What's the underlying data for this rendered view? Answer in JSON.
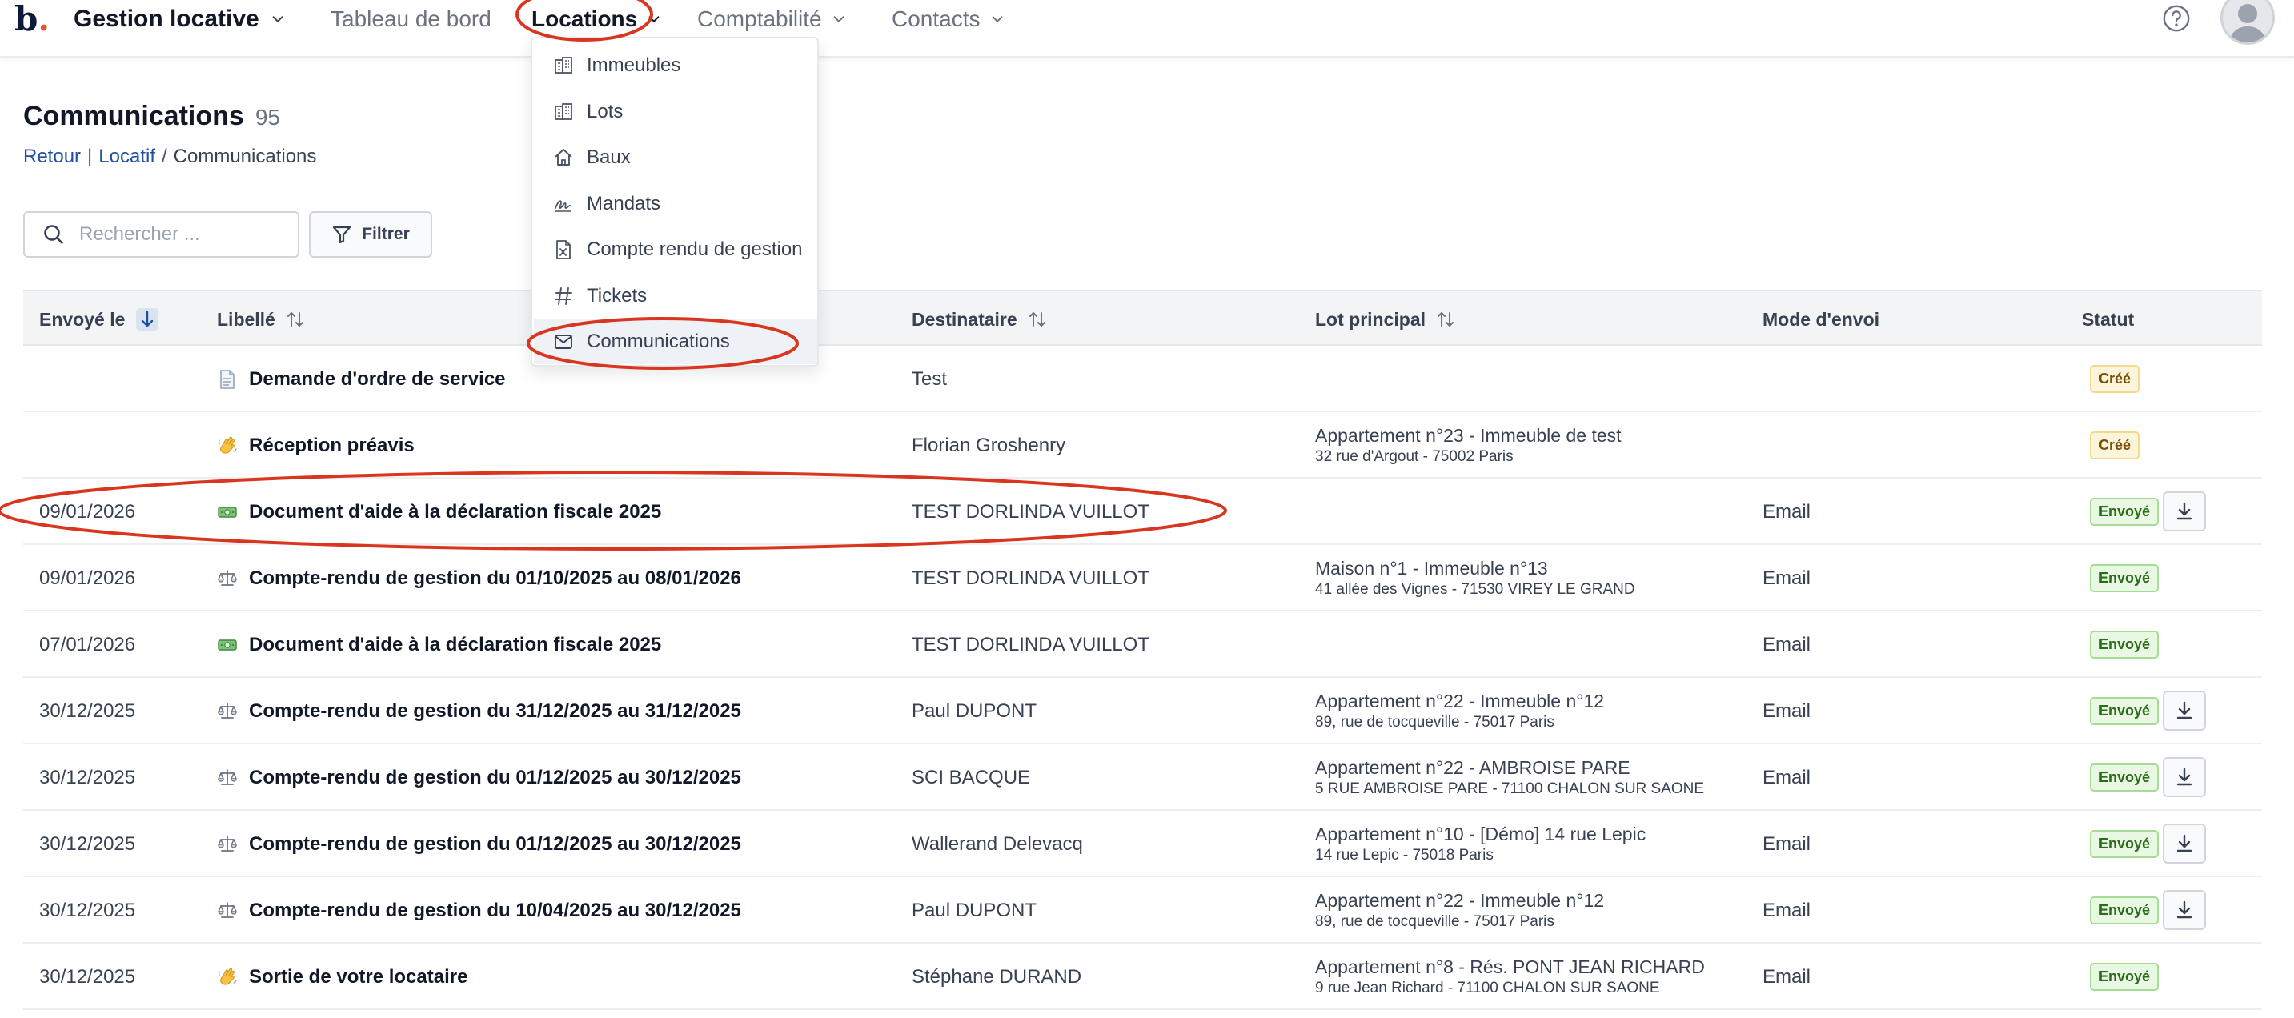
{
  "app": {
    "logo_letter": "b",
    "logo_dot": ".",
    "title": "Gestion locative"
  },
  "nav": {
    "items": [
      {
        "label": "Tableau de bord"
      },
      {
        "label": "Locations"
      },
      {
        "label": "Comptabilité"
      },
      {
        "label": "Contacts"
      }
    ]
  },
  "dropdown": {
    "items": [
      {
        "label": "Immeubles",
        "icon": "building-icon"
      },
      {
        "label": "Lots",
        "icon": "building-icon"
      },
      {
        "label": "Baux",
        "icon": "home-icon"
      },
      {
        "label": "Mandats",
        "icon": "signature-icon"
      },
      {
        "label": "Compte rendu de gestion",
        "icon": "spreadsheet-icon"
      },
      {
        "label": "Tickets",
        "icon": "hash-icon"
      },
      {
        "label": "Communications",
        "icon": "envelope-icon",
        "selected": true
      }
    ]
  },
  "page": {
    "title": "Communications",
    "count": "95",
    "breadcrumb": {
      "back": "Retour",
      "sep1": "|",
      "section": "Locatif",
      "sep2": "/",
      "current": "Communications"
    }
  },
  "toolbar": {
    "search_placeholder": "Rechercher ...",
    "filter_label": "Filtrer"
  },
  "table": {
    "columns": {
      "sent": "Envoyé le",
      "label": "Libellé",
      "recipient": "Destinataire",
      "lot": "Lot principal",
      "mode": "Mode d'envoi",
      "status": "Statut"
    },
    "rows": [
      {
        "date": "",
        "icon": "document-icon",
        "label": "Demande d'ordre de service",
        "recipient": "Test",
        "lot_name": "",
        "lot_address": "",
        "mode": "",
        "status": "Créé",
        "download": false
      },
      {
        "date": "",
        "icon": "waving-hand-icon",
        "label": "Réception préavis",
        "recipient": "Florian Groshenry",
        "lot_name": "Appartement n°23 - Immeuble de test",
        "lot_address": "32 rue d'Argout - 75002 Paris",
        "mode": "",
        "status": "Créé",
        "download": false
      },
      {
        "date": "09/01/2026",
        "icon": "banknote-icon",
        "label": "Document d'aide à la déclaration fiscale 2025",
        "recipient": "TEST DORLINDA VUILLOT",
        "lot_name": "",
        "lot_address": "",
        "mode": "Email",
        "status": "Envoyé",
        "download": true
      },
      {
        "date": "09/01/2026",
        "icon": "scales-icon",
        "label": "Compte-rendu de gestion du 01/10/2025 au 08/01/2026",
        "recipient": "TEST DORLINDA VUILLOT",
        "lot_name": "Maison n°1 - Immeuble n°13",
        "lot_address": "41 allée des Vignes - 71530 VIREY LE GRAND",
        "mode": "Email",
        "status": "Envoyé",
        "download": false
      },
      {
        "date": "07/01/2026",
        "icon": "banknote-icon",
        "label": "Document d'aide à la déclaration fiscale 2025",
        "recipient": "TEST DORLINDA VUILLOT",
        "lot_name": "",
        "lot_address": "",
        "mode": "Email",
        "status": "Envoyé",
        "download": false
      },
      {
        "date": "30/12/2025",
        "icon": "scales-icon",
        "label": "Compte-rendu de gestion du 31/12/2025 au 31/12/2025",
        "recipient": "Paul DUPONT",
        "lot_name": "Appartement n°22 - Immeuble n°12",
        "lot_address": "89, rue de tocqueville - 75017 Paris",
        "mode": "Email",
        "status": "Envoyé",
        "download": true
      },
      {
        "date": "30/12/2025",
        "icon": "scales-icon",
        "label": "Compte-rendu de gestion du 01/12/2025 au 30/12/2025",
        "recipient": "SCI BACQUE",
        "lot_name": "Appartement n°22 - AMBROISE PARE",
        "lot_address": "5 RUE AMBROISE PARE - 71100 CHALON SUR SAONE",
        "mode": "Email",
        "status": "Envoyé",
        "download": true
      },
      {
        "date": "30/12/2025",
        "icon": "scales-icon",
        "label": "Compte-rendu de gestion du 01/12/2025 au 30/12/2025",
        "recipient": "Wallerand Delevacq",
        "lot_name": "Appartement n°10 - [Démo] 14 rue Lepic",
        "lot_address": "14 rue Lepic - 75018 Paris",
        "mode": "Email",
        "status": "Envoyé",
        "download": true
      },
      {
        "date": "30/12/2025",
        "icon": "scales-icon",
        "label": "Compte-rendu de gestion du 10/04/2025 au 30/12/2025",
        "recipient": "Paul DUPONT",
        "lot_name": "Appartement n°22 - Immeuble n°12",
        "lot_address": "89, rue de tocqueville - 75017 Paris",
        "mode": "Email",
        "status": "Envoyé",
        "download": true
      },
      {
        "date": "30/12/2025",
        "icon": "waving-hand-icon",
        "label": "Sortie de votre locataire",
        "recipient": "Stéphane DURAND",
        "lot_name": "Appartement n°8 - Rés. PONT JEAN RICHARD",
        "lot_address": "9 rue Jean Richard - 71100 CHALON SUR SAONE",
        "mode": "Email",
        "status": "Envoyé",
        "download": false
      }
    ]
  },
  "colors": {
    "annotation_red": "#d9361f",
    "link_blue": "#1e4fa3",
    "badge_cree_bg": "#fdf4dc",
    "badge_envoye_bg": "#e9f8e3"
  }
}
